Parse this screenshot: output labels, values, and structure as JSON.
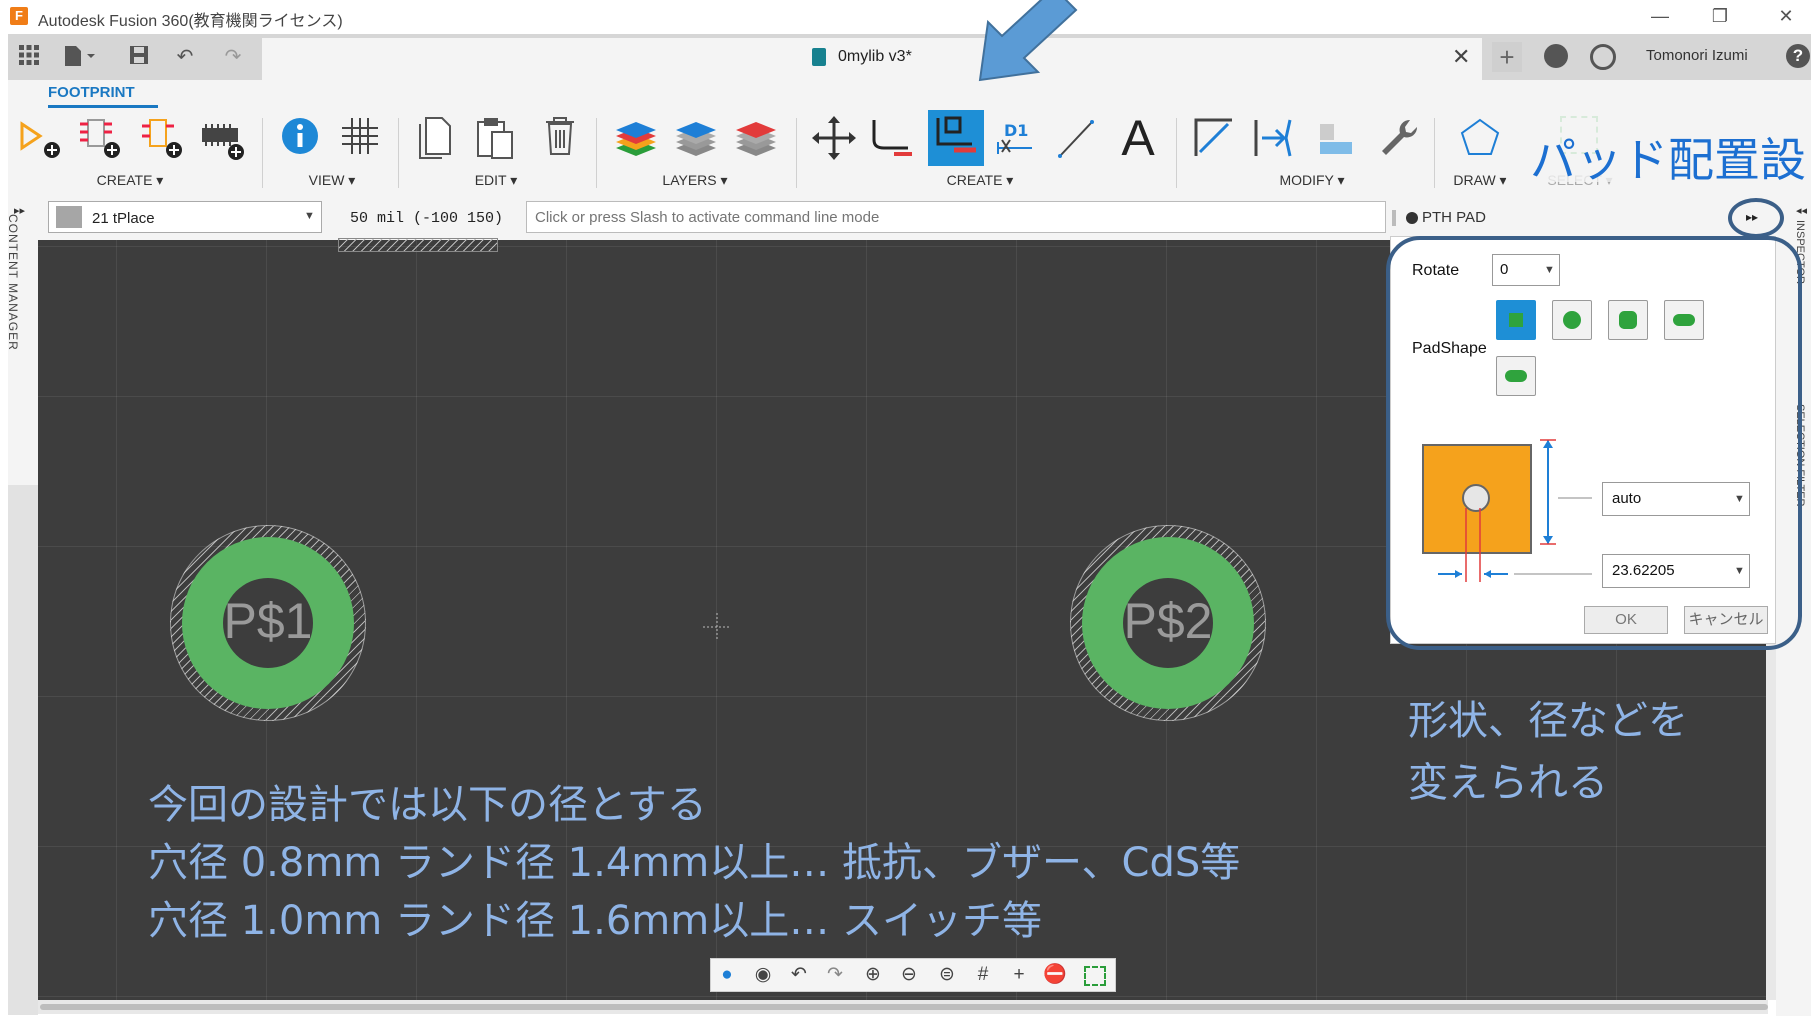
{
  "window": {
    "title": "Autodesk Fusion 360(教育機関ライセンス)",
    "app_icon_letter": "F",
    "minimize": "—",
    "restore": "❐",
    "close": "✕"
  },
  "tabbar": {
    "document_title": "0mylib v3*",
    "close_tab": "✕",
    "user_name": "Tomonori Izumi"
  },
  "toolbar": {
    "active_tab": "FOOTPRINT",
    "groups": {
      "create": "CREATE ▾",
      "view": "VIEW ▾",
      "edit": "EDIT ▾",
      "layers": "LAYERS ▾",
      "create2": "CREATE ▾",
      "modify": "MODIFY ▾",
      "draw": "DRAW ▾",
      "select": "SELECT ▾"
    },
    "text_tool": "A",
    "d1_label": "D1"
  },
  "propbar": {
    "layer": "21 tPlace",
    "grid_readout": "50 mil (-100 150)",
    "command_placeholder": "Click or press Slash to activate command line mode"
  },
  "side_panels": {
    "content_manager": "CONTENT MANAGER"
  },
  "canvas": {
    "pad1_label": "P$1",
    "pad2_label": "P$2"
  },
  "pth_pad": {
    "title": "PTH PAD",
    "collapse": "▸▸",
    "rotate_label": "Rotate",
    "rotate_value": "0",
    "padshape_label": "PadShape",
    "diameter_value": "auto",
    "drill_value": "23.62205",
    "ok": "OK",
    "cancel": "キャンセル"
  },
  "annotations": {
    "overlay_title": "パッド配置設",
    "shape_note_line1": "形状、径などを",
    "shape_note_line2": "変えられる",
    "design_line1": "今回の設計では以下の径とする",
    "design_line2": "穴径 0.8mm ランド径 1.4mm以上… 抵抗、ブザー、CdS等",
    "design_line3": "穴径 1.0mm ランド径 1.6mm以上… スイッチ等"
  },
  "colors": {
    "canvas_bg": "#3d3d3d",
    "pad_green": "#5ab463",
    "accent_blue": "#1a78c2",
    "annotation_blue": "#8fb4e6",
    "arrow_blue": "#5b9bd5",
    "outline_navy": "#3b5f88"
  }
}
